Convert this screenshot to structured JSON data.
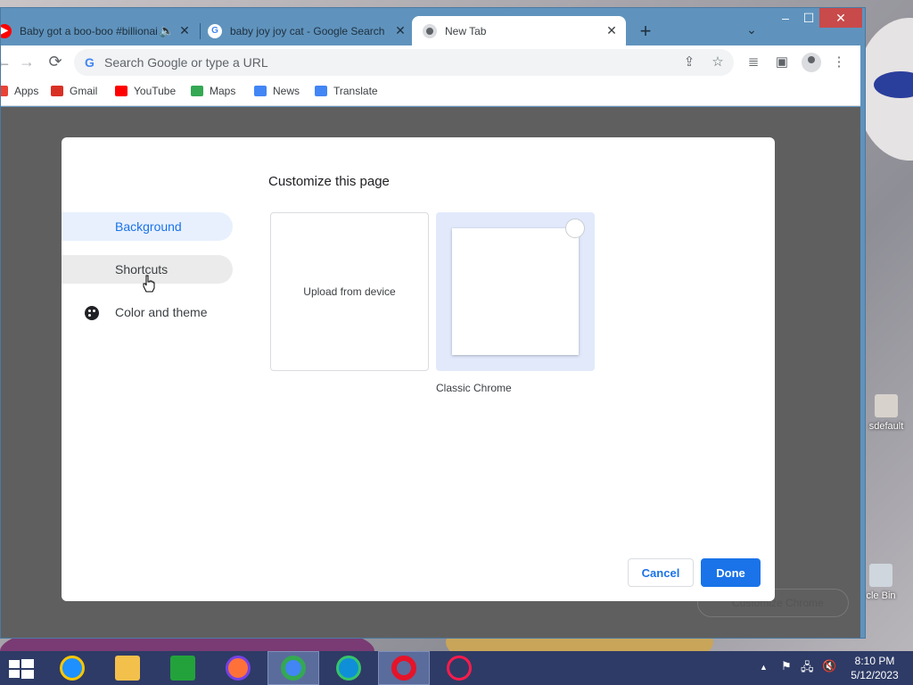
{
  "window": {
    "tabs": [
      {
        "title": "Baby got a boo-boo #billionaire",
        "close": "✕",
        "audio": "🔈"
      },
      {
        "title": "baby joy joy cat - Google Search",
        "close": "✕"
      },
      {
        "title": "New Tab",
        "close": "✕"
      }
    ],
    "new_tab": "+",
    "tab_search": "⌄",
    "controls": {
      "minimize": "–",
      "maximize": "☐",
      "close": "✕"
    }
  },
  "toolbar": {
    "back": "←",
    "forward": "→",
    "reload": "⟳",
    "omnibox_placeholder": "Search Google or type a URL",
    "share": "⇪",
    "bookmark_star": "☆",
    "media": "≣",
    "side_panel": "▣",
    "menu": "⋮"
  },
  "bookmarks": [
    {
      "label": "Apps",
      "color": "#ea4335"
    },
    {
      "label": "Gmail",
      "color": "#d93025"
    },
    {
      "label": "YouTube",
      "color": "#ff0000"
    },
    {
      "label": "Maps",
      "color": "#34a853"
    },
    {
      "label": "News",
      "color": "#4285f4"
    },
    {
      "label": "Translate",
      "color": "#4285f4"
    }
  ],
  "dialog": {
    "title": "Customize this page",
    "sidebar": [
      {
        "label": "Background",
        "state": "selected"
      },
      {
        "label": "Shortcuts",
        "state": "hover"
      },
      {
        "label": "Color and theme",
        "state": "normal"
      }
    ],
    "tiles": {
      "upload": "Upload from device",
      "classic": "Classic Chrome"
    },
    "cancel": "Cancel",
    "done": "Done"
  },
  "customize_chrome_button": "Customize Chrome",
  "desktop_icons": [
    {
      "label": "sdefault"
    },
    {
      "label": "cle Bin"
    }
  ],
  "taskbar": {
    "apps": [
      "start",
      "internet-explorer",
      "file-explorer",
      "store",
      "firefox",
      "chrome",
      "edge",
      "opera",
      "opera-gx"
    ],
    "tray": {
      "chevron": "▲",
      "flag": "⚑",
      "network": "🖧",
      "volume": "🔇"
    },
    "time": "8:10 PM",
    "date": "5/12/2023"
  },
  "colors": {
    "accent": "#1a73e8",
    "tabstrip": "#5f93bd",
    "selected_bg": "#e8f0fe"
  }
}
